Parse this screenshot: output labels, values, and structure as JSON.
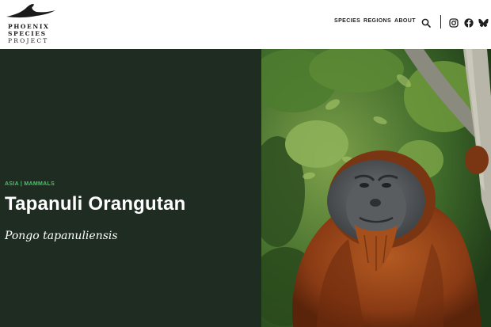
{
  "brand": {
    "line1": "PHOENIX",
    "line2": "SPECIES",
    "line3": "PROJECT"
  },
  "nav": {
    "items": [
      {
        "label": "SPECIES"
      },
      {
        "label": "REGIONS"
      },
      {
        "label": "ABOUT"
      }
    ]
  },
  "icons": {
    "search": "search-icon",
    "instagram": "instagram-icon",
    "facebook": "facebook-icon",
    "bluesky": "bluesky-icon"
  },
  "hero": {
    "category": "ASIA | MAMMALS",
    "title": "Tapanuli Orangutan",
    "scientific_name": "Pongo tapanuliensis",
    "panel_color": "#1e2c22",
    "accent_color": "#4fc06a"
  }
}
